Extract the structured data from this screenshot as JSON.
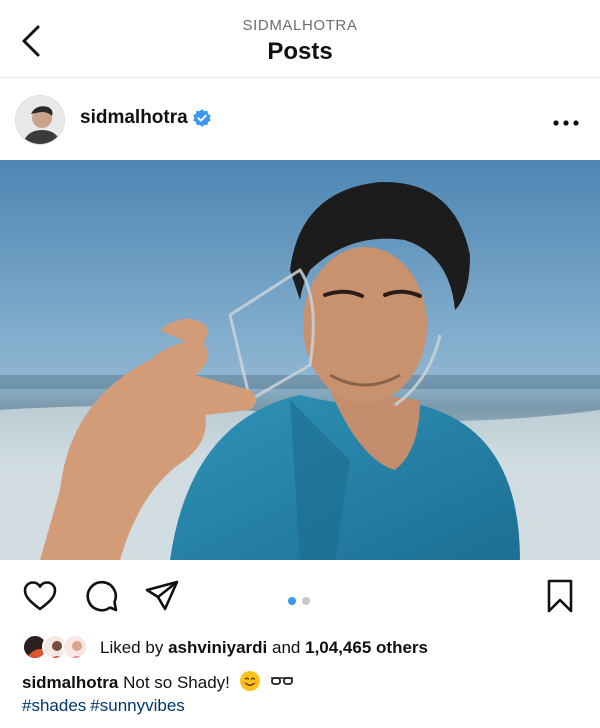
{
  "header": {
    "subtitle": "SIDMALHOTRA",
    "title": "Posts",
    "back_icon": "chevron-left-icon"
  },
  "post": {
    "username": "sidmalhotra",
    "verified_icon": "verified-badge-icon",
    "more_icon": "more-horizontal-icon",
    "carousel": {
      "count": 2,
      "active_index": 0
    },
    "likes": {
      "prefix": "Liked by",
      "liker": "ashviniyardi",
      "connector": "and",
      "count": "1,04,465 others"
    },
    "caption": {
      "username": "sidmalhotra",
      "text": "Not so Shady!"
    },
    "hashtags": [
      "#shades",
      "#sunnyvibes"
    ]
  },
  "actions": {
    "like_icon": "heart-icon",
    "comment_icon": "comment-icon",
    "share_icon": "send-icon",
    "save_icon": "bookmark-icon"
  },
  "colors": {
    "text": "#111111",
    "muted": "#6e6e6e",
    "verified": "#3897f0",
    "link": "#00376b",
    "active_dot": "#3897f0",
    "inactive_dot": "#c7c7c7"
  }
}
